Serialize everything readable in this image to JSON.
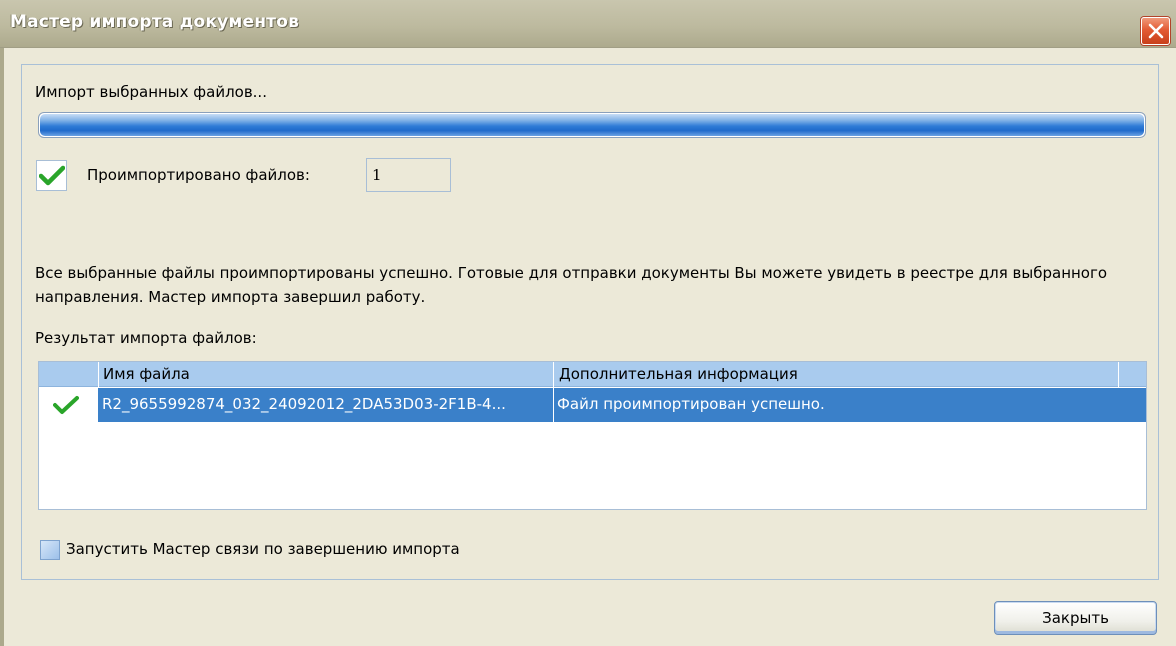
{
  "window": {
    "title": "Мастер импорта документов"
  },
  "status": {
    "text": "Импорт выбранных файлов...",
    "progress_fraction": 1.0
  },
  "imported": {
    "label": "Проимпортировано файлов:",
    "count": "1"
  },
  "message": "Все выбранные файлы проимпортированы успешно. Готовые для отправки документы Вы можете увидеть в реестре для выбранного направления. Мастер импорта завершил работу.",
  "results": {
    "label": "Результат импорта файлов:",
    "columns": [
      "Имя файла",
      "Дополнительная информация"
    ],
    "rows": [
      {
        "status_icon": "check-icon",
        "file_name": "R2_9655992874_032_24092012_2DA53D03-2F1B-4...",
        "info": "Файл проимпортирован успешно."
      }
    ]
  },
  "launch_wizard": {
    "label": "Запустить Мастер связи по завершению импорта",
    "checked": false
  },
  "buttons": {
    "close_label": "Закрыть"
  },
  "colors": {
    "selection": "#3a80c9",
    "progress": "#2f7bd6",
    "check": "#2aa52a",
    "close_button": "#e35b35"
  }
}
